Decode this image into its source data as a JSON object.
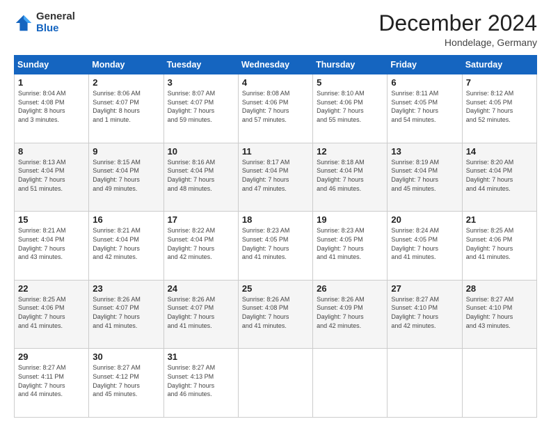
{
  "logo": {
    "general": "General",
    "blue": "Blue"
  },
  "header": {
    "month": "December 2024",
    "location": "Hondelage, Germany"
  },
  "days_of_week": [
    "Sunday",
    "Monday",
    "Tuesday",
    "Wednesday",
    "Thursday",
    "Friday",
    "Saturday"
  ],
  "weeks": [
    [
      {
        "day": "1",
        "sunrise": "8:04 AM",
        "sunset": "4:08 PM",
        "daylight": "8 hours and 3 minutes."
      },
      {
        "day": "2",
        "sunrise": "8:06 AM",
        "sunset": "4:07 PM",
        "daylight": "8 hours and 1 minute."
      },
      {
        "day": "3",
        "sunrise": "8:07 AM",
        "sunset": "4:07 PM",
        "daylight": "7 hours and 59 minutes."
      },
      {
        "day": "4",
        "sunrise": "8:08 AM",
        "sunset": "4:06 PM",
        "daylight": "7 hours and 57 minutes."
      },
      {
        "day": "5",
        "sunrise": "8:10 AM",
        "sunset": "4:06 PM",
        "daylight": "7 hours and 55 minutes."
      },
      {
        "day": "6",
        "sunrise": "8:11 AM",
        "sunset": "4:05 PM",
        "daylight": "7 hours and 54 minutes."
      },
      {
        "day": "7",
        "sunrise": "8:12 AM",
        "sunset": "4:05 PM",
        "daylight": "7 hours and 52 minutes."
      }
    ],
    [
      {
        "day": "8",
        "sunrise": "8:13 AM",
        "sunset": "4:04 PM",
        "daylight": "7 hours and 51 minutes."
      },
      {
        "day": "9",
        "sunrise": "8:15 AM",
        "sunset": "4:04 PM",
        "daylight": "7 hours and 49 minutes."
      },
      {
        "day": "10",
        "sunrise": "8:16 AM",
        "sunset": "4:04 PM",
        "daylight": "7 hours and 48 minutes."
      },
      {
        "day": "11",
        "sunrise": "8:17 AM",
        "sunset": "4:04 PM",
        "daylight": "7 hours and 47 minutes."
      },
      {
        "day": "12",
        "sunrise": "8:18 AM",
        "sunset": "4:04 PM",
        "daylight": "7 hours and 46 minutes."
      },
      {
        "day": "13",
        "sunrise": "8:19 AM",
        "sunset": "4:04 PM",
        "daylight": "7 hours and 45 minutes."
      },
      {
        "day": "14",
        "sunrise": "8:20 AM",
        "sunset": "4:04 PM",
        "daylight": "7 hours and 44 minutes."
      }
    ],
    [
      {
        "day": "15",
        "sunrise": "8:21 AM",
        "sunset": "4:04 PM",
        "daylight": "7 hours and 43 minutes."
      },
      {
        "day": "16",
        "sunrise": "8:21 AM",
        "sunset": "4:04 PM",
        "daylight": "7 hours and 42 minutes."
      },
      {
        "day": "17",
        "sunrise": "8:22 AM",
        "sunset": "4:04 PM",
        "daylight": "7 hours and 42 minutes."
      },
      {
        "day": "18",
        "sunrise": "8:23 AM",
        "sunset": "4:05 PM",
        "daylight": "7 hours and 41 minutes."
      },
      {
        "day": "19",
        "sunrise": "8:23 AM",
        "sunset": "4:05 PM",
        "daylight": "7 hours and 41 minutes."
      },
      {
        "day": "20",
        "sunrise": "8:24 AM",
        "sunset": "4:05 PM",
        "daylight": "7 hours and 41 minutes."
      },
      {
        "day": "21",
        "sunrise": "8:25 AM",
        "sunset": "4:06 PM",
        "daylight": "7 hours and 41 minutes."
      }
    ],
    [
      {
        "day": "22",
        "sunrise": "8:25 AM",
        "sunset": "4:06 PM",
        "daylight": "7 hours and 41 minutes."
      },
      {
        "day": "23",
        "sunrise": "8:26 AM",
        "sunset": "4:07 PM",
        "daylight": "7 hours and 41 minutes."
      },
      {
        "day": "24",
        "sunrise": "8:26 AM",
        "sunset": "4:07 PM",
        "daylight": "7 hours and 41 minutes."
      },
      {
        "day": "25",
        "sunrise": "8:26 AM",
        "sunset": "4:08 PM",
        "daylight": "7 hours and 41 minutes."
      },
      {
        "day": "26",
        "sunrise": "8:26 AM",
        "sunset": "4:09 PM",
        "daylight": "7 hours and 42 minutes."
      },
      {
        "day": "27",
        "sunrise": "8:27 AM",
        "sunset": "4:10 PM",
        "daylight": "7 hours and 42 minutes."
      },
      {
        "day": "28",
        "sunrise": "8:27 AM",
        "sunset": "4:10 PM",
        "daylight": "7 hours and 43 minutes."
      }
    ],
    [
      {
        "day": "29",
        "sunrise": "8:27 AM",
        "sunset": "4:11 PM",
        "daylight": "7 hours and 44 minutes."
      },
      {
        "day": "30",
        "sunrise": "8:27 AM",
        "sunset": "4:12 PM",
        "daylight": "7 hours and 45 minutes."
      },
      {
        "day": "31",
        "sunrise": "8:27 AM",
        "sunset": "4:13 PM",
        "daylight": "7 hours and 46 minutes."
      },
      null,
      null,
      null,
      null
    ]
  ],
  "labels": {
    "sunrise": "Sunrise: ",
    "sunset": "Sunset: ",
    "daylight": "Daylight hours"
  }
}
